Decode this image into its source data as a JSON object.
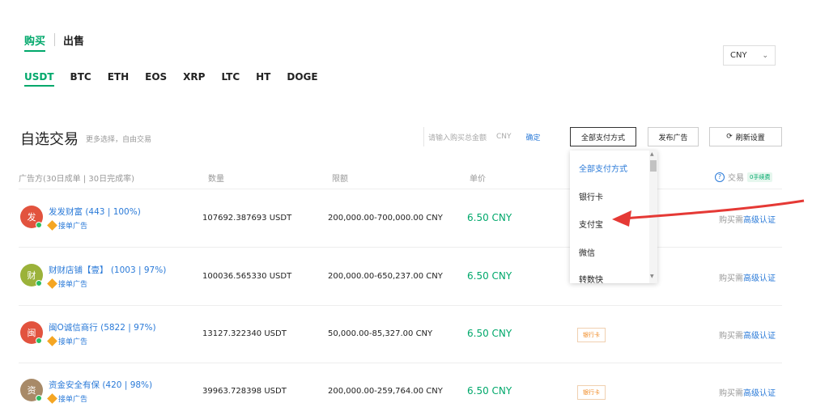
{
  "tabs": {
    "buy": "购买",
    "sell": "出售"
  },
  "coins": [
    "USDT",
    "BTC",
    "ETH",
    "EOS",
    "XRP",
    "LTC",
    "HT",
    "DOGE"
  ],
  "currency": {
    "value": "CNY"
  },
  "section": {
    "title": "自选交易",
    "subtitle": "更多选择，自由交易"
  },
  "filters": {
    "amount_placeholder": "请输入购买总金额",
    "amount_unit": "CNY",
    "confirm": "确定",
    "pay_method": "全部支付方式",
    "post_ad": "发布广告",
    "refresh": "刷新设置"
  },
  "table": {
    "headers": {
      "advertiser": "广告方(30日成单 | 30日完成率)",
      "quantity": "数量",
      "limit": "限额",
      "price": "单价",
      "trade": "交易",
      "badge": "0手续费"
    }
  },
  "rows": [
    {
      "avatar": "发",
      "avatar_color": "#e2533e",
      "name": "发发财富 (443 | 100%)",
      "badge": "接单广告",
      "qty": "107692.387693 USDT",
      "limit": "200,000.00-700,000.00 CNY",
      "price": "6.50 CNY",
      "bank": "",
      "action_a": "购买需",
      "action_b": "高级认证"
    },
    {
      "avatar": "财",
      "avatar_color": "#9bb23a",
      "name": "财财店铺【壹】 (1003 | 97%)",
      "badge": "接单广告",
      "qty": "100036.565330 USDT",
      "limit": "200,000.00-650,237.00 CNY",
      "price": "6.50 CNY",
      "bank": "",
      "action_a": "购买需",
      "action_b": "高级认证"
    },
    {
      "avatar": "闽",
      "avatar_color": "#e2533e",
      "name": "闽O诚信商行 (5822 | 97%)",
      "badge": "接单广告",
      "qty": "13127.322340 USDT",
      "limit": "50,000.00-85,327.00 CNY",
      "price": "6.50 CNY",
      "bank": "银行卡",
      "action_a": "购买需",
      "action_b": "高级认证"
    },
    {
      "avatar": "资",
      "avatar_color": "#a88a68",
      "name": "资金安全有保 (420 | 98%)",
      "badge": "接单广告",
      "qty": "39963.728398 USDT",
      "limit": "200,000.00-259,764.00 CNY",
      "price": "6.50 CNY",
      "bank": "银行卡",
      "action_a": "购买需",
      "action_b": "高级认证"
    }
  ],
  "dropdown": {
    "items": [
      "全部支付方式",
      "银行卡",
      "支付宝",
      "微信",
      "转数快"
    ]
  },
  "colors": {
    "green": "#00a86b",
    "blue": "#2a7ad8",
    "arrow": "#e53935"
  }
}
